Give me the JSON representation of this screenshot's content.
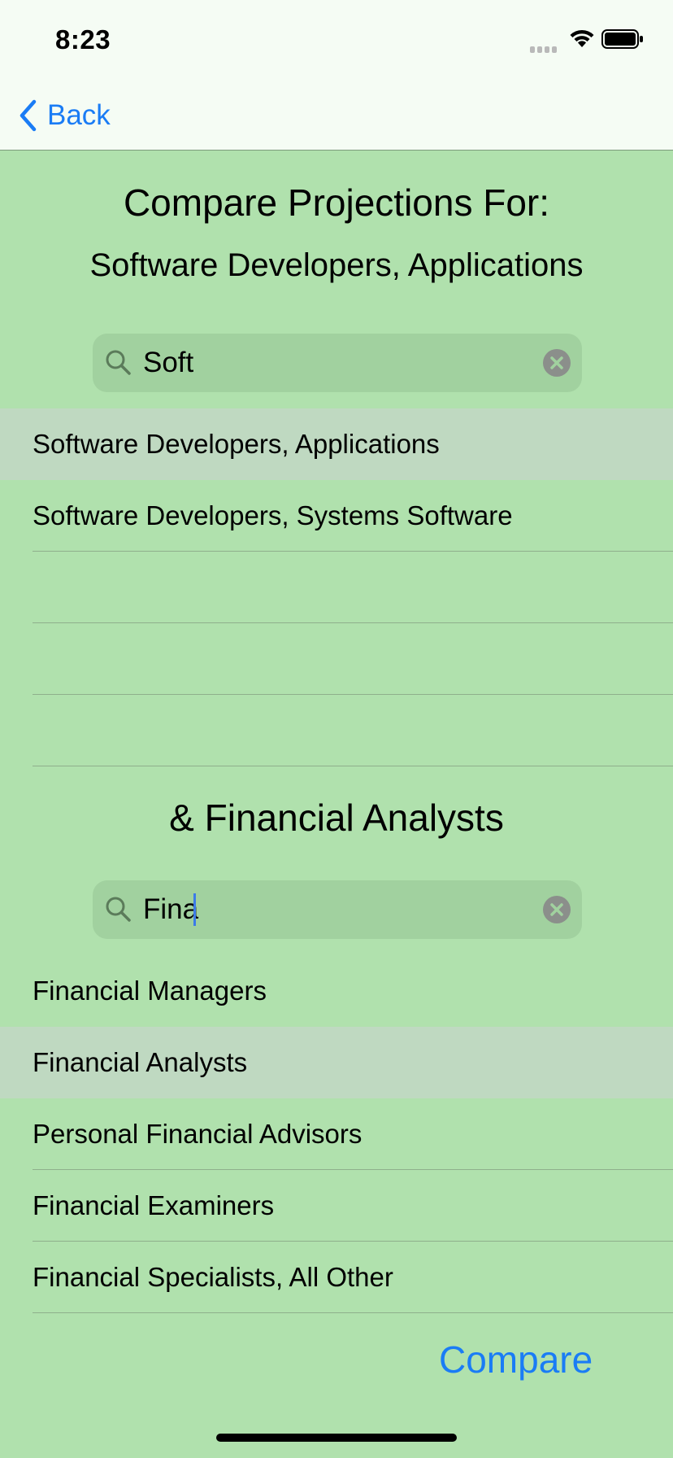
{
  "status_bar": {
    "time": "8:23"
  },
  "nav": {
    "back_label": "Back"
  },
  "header": {
    "title": "Compare Projections For:",
    "first_selection": "Software Developers, Applications",
    "second_selection": "& Financial Analysts"
  },
  "first_search": {
    "value": "Soft",
    "placeholder": "",
    "results": [
      {
        "label": "Software Developers, Applications",
        "selected": true
      },
      {
        "label": "Software Developers, Systems Software",
        "selected": false
      },
      {
        "label": "",
        "selected": false
      },
      {
        "label": "",
        "selected": false
      },
      {
        "label": "",
        "selected": false
      }
    ]
  },
  "second_search": {
    "value": "Fina",
    "placeholder": "",
    "results": [
      {
        "label": "Financial Managers",
        "selected": false
      },
      {
        "label": "Financial Analysts",
        "selected": true
      },
      {
        "label": "Personal Financial Advisors",
        "selected": false
      },
      {
        "label": "Financial Examiners",
        "selected": false
      },
      {
        "label": "Financial Specialists, All Other",
        "selected": false
      }
    ]
  },
  "actions": {
    "compare_label": "Compare"
  },
  "colors": {
    "background": "#b0e1ad",
    "bar_background": "#f5fcf4",
    "accent": "#1a7cf5",
    "selected_row": "#bfd9c1",
    "search_field": "#a1d19f"
  }
}
